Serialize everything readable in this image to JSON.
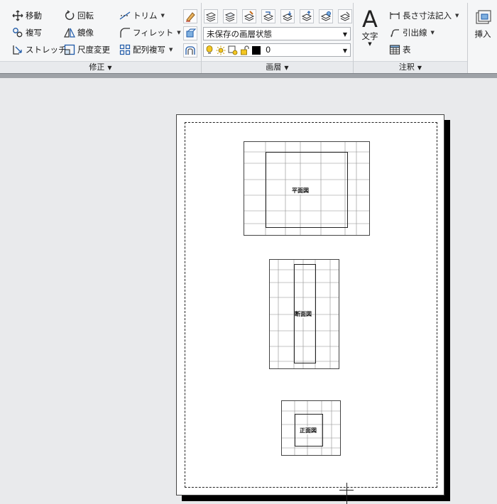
{
  "ribbon": {
    "modify": {
      "title": "修正",
      "move": "移動",
      "rotate": "回転",
      "trim": "トリム",
      "copy": "複写",
      "mirror": "鏡像",
      "fillet": "フィレット",
      "stretch": "ストレッチ",
      "scale": "尺度変更",
      "array": "配列複写"
    },
    "layers": {
      "title": "画層",
      "layer_state": "未保存の画層状態",
      "current_layer": "0"
    },
    "annotation": {
      "title": "注釈",
      "text": "文字",
      "linear_dim": "長さ寸法記入",
      "leader": "引出線",
      "table": "表"
    },
    "block": {
      "insert": "挿入"
    }
  },
  "drawing": {
    "plan_label": "平面図",
    "section_label": "断面図",
    "elevation_label": "正面図"
  },
  "colors": {
    "layer_color": "#000000",
    "bulb": "#f3c623"
  }
}
